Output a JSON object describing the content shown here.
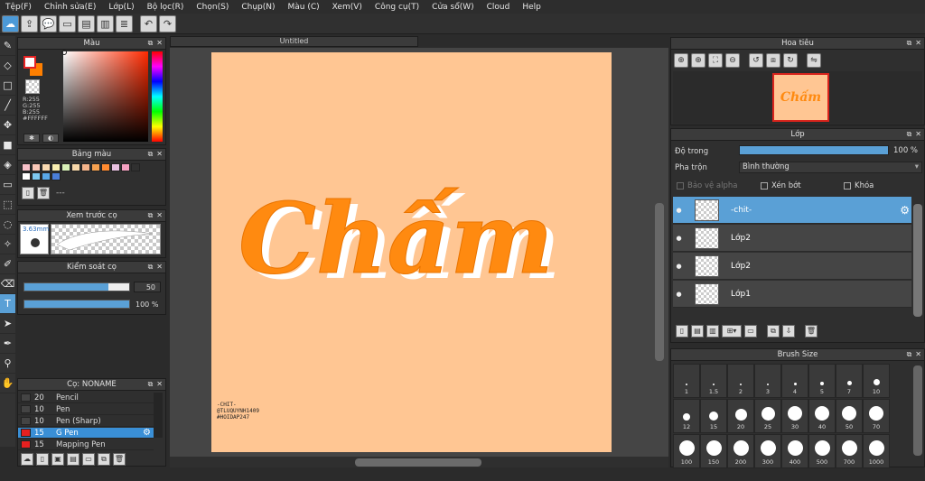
{
  "menu": [
    "Tệp(F)",
    "Chỉnh sửa(E)",
    "Lớp(L)",
    "Bộ lọc(R)",
    "Chọn(S)",
    "Chụp(N)",
    "Màu (C)",
    "Xem(V)",
    "Công cụ(T)",
    "Cửa sổ(W)",
    "Cloud",
    "Help"
  ],
  "document_title": "Untitled",
  "panels": {
    "color": "Màu",
    "palette": "Bảng màu",
    "preview": "Xem trước cọ",
    "control": "Kiểm soát cọ",
    "brush": "Cọ: NONAME",
    "navigator": "Hoa tiêu",
    "layer": "Lớp",
    "brush_size": "Brush Size"
  },
  "color": {
    "r": "R:255",
    "g": "G:255",
    "b": "B:255",
    "hex": "#FFFFFF",
    "foreground": "#ffffff",
    "background": "#ff7f00"
  },
  "palette": {
    "swatches": [
      "#f7c0c8",
      "#f9c8b8",
      "#f8d9b0",
      "#f8eeb0",
      "#d8f0b8",
      "#f6d6a8",
      "#f4b48a",
      "#f4a050",
      "#ff8a30",
      "#e8c0e0",
      "#f4a0c0",
      "#303030",
      "#ffffff",
      "#7ec8f0",
      "#5aa8e8",
      "#4a7ed8"
    ],
    "placeholder": "---"
  },
  "preview": {
    "size": "3.63mm"
  },
  "control": {
    "size": "50",
    "opacity": "100 %",
    "size_fraction": 0.8,
    "opacity_fraction": 1.0
  },
  "brushes": [
    {
      "size": "20",
      "name": "Pencil",
      "color": "#444444"
    },
    {
      "size": "10",
      "name": "Pen",
      "color": "#444444"
    },
    {
      "size": "10",
      "name": "Pen (Sharp)",
      "color": "#444444"
    },
    {
      "size": "15",
      "name": "G Pen",
      "color": "#e62020",
      "selected": true
    },
    {
      "size": "15",
      "name": "Mapping Pen",
      "color": "#e62020"
    }
  ],
  "canvas": {
    "lettering": "Chấm",
    "credit": [
      "-CHIT-",
      "@TLUQUYNH1409",
      "#HOIDAP247"
    ],
    "letter_color": "#ff8a10",
    "paper_color": "#ffc693"
  },
  "layer": {
    "opacity_label": "Độ trong",
    "opacity_value": "100 %",
    "blend_label": "Pha trộn",
    "blend_value": "Bình thường",
    "protect_alpha": "Bảo vệ alpha",
    "clipping": "Xén bớt",
    "lock": "Khóa",
    "layers": [
      {
        "name": "-chit-",
        "selected": true
      },
      {
        "name": "Lớp2"
      },
      {
        "name": "Lớp2"
      },
      {
        "name": "Lớp1"
      }
    ]
  },
  "brush_sizes": [
    {
      "label": "1",
      "d": 1
    },
    {
      "label": "1.5",
      "d": 1.5
    },
    {
      "label": "2",
      "d": 2
    },
    {
      "label": "3",
      "d": 2.5
    },
    {
      "label": "4",
      "d": 3
    },
    {
      "label": "5",
      "d": 4
    },
    {
      "label": "7",
      "d": 5
    },
    {
      "label": "10",
      "d": 7
    },
    {
      "label": "12",
      "d": 8
    },
    {
      "label": "15",
      "d": 10
    },
    {
      "label": "20",
      "d": 13
    },
    {
      "label": "25",
      "d": 15
    },
    {
      "label": "30",
      "d": 16
    },
    {
      "label": "40",
      "d": 16
    },
    {
      "label": "50",
      "d": 16
    },
    {
      "label": "70",
      "d": 16
    },
    {
      "label": "100",
      "d": 17
    },
    {
      "label": "150",
      "d": 17
    },
    {
      "label": "200",
      "d": 17
    },
    {
      "label": "300",
      "d": 17
    },
    {
      "label": "400",
      "d": 17
    },
    {
      "label": "500",
      "d": 17
    },
    {
      "label": "700",
      "d": 17
    },
    {
      "label": "1000",
      "d": 17
    }
  ]
}
